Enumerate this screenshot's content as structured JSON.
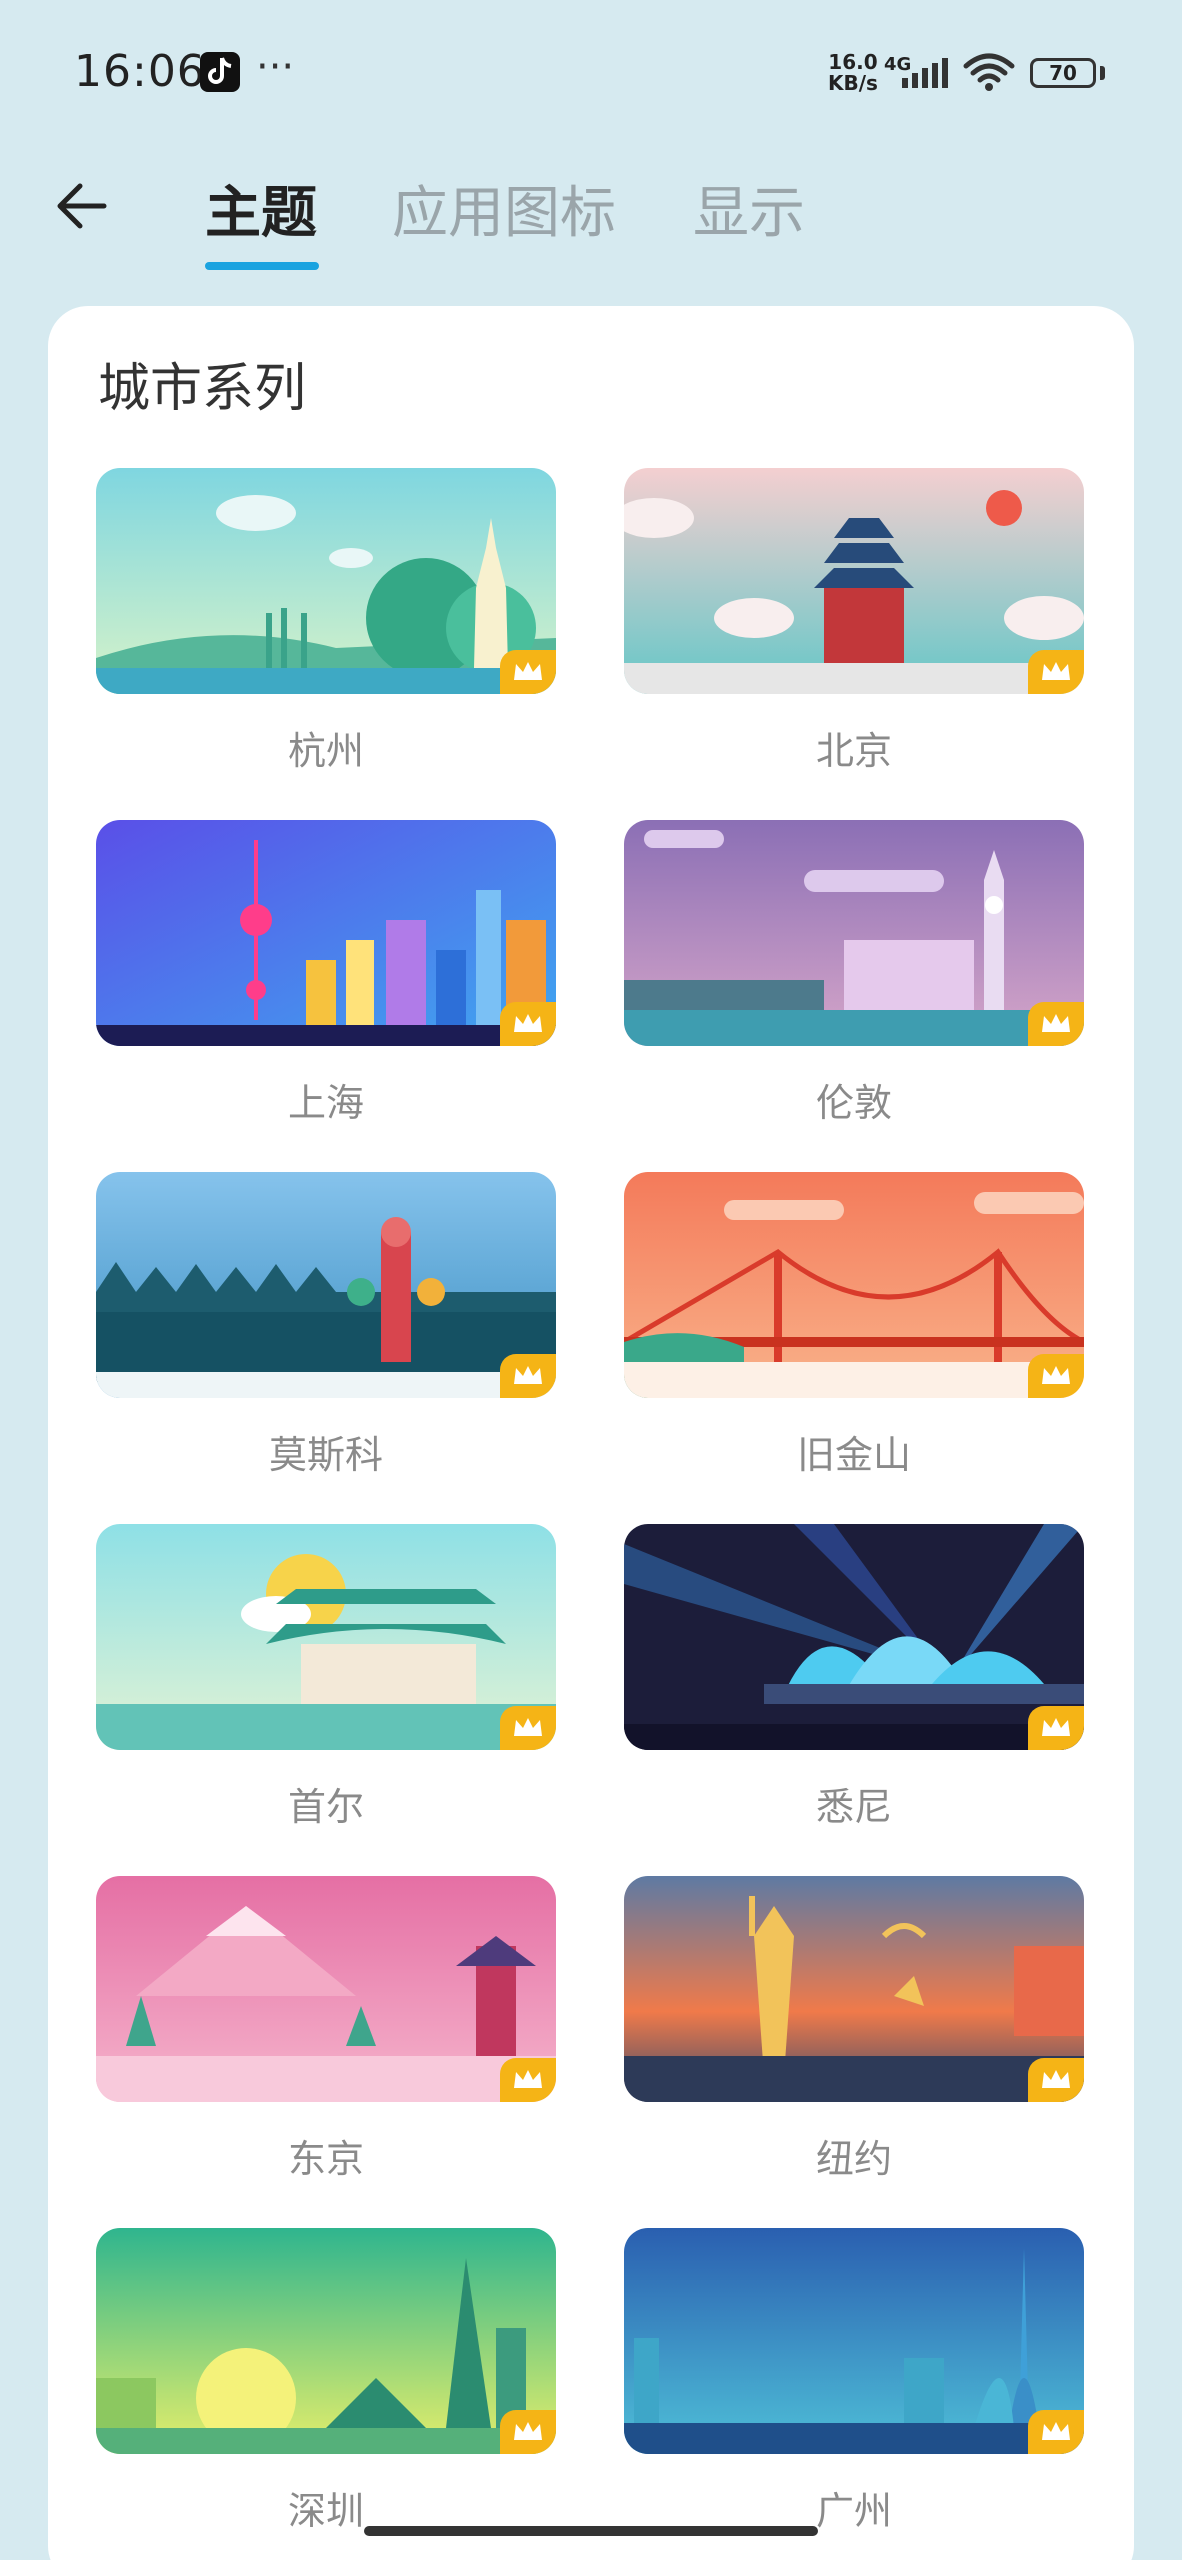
{
  "status": {
    "time": "16:06",
    "more": "···",
    "net_speed_value": "16.0",
    "net_speed_unit": "KB/s",
    "network": "4G",
    "battery": "70"
  },
  "header": {
    "tabs": [
      {
        "label": "主题",
        "active": true
      },
      {
        "label": "应用图标",
        "active": false
      },
      {
        "label": "显示",
        "active": false
      }
    ]
  },
  "section": {
    "title": "城市系列",
    "items": [
      {
        "label": "杭州",
        "premium": true
      },
      {
        "label": "北京",
        "premium": true
      },
      {
        "label": "上海",
        "premium": true
      },
      {
        "label": "伦敦",
        "premium": true
      },
      {
        "label": "莫斯科",
        "premium": true
      },
      {
        "label": "旧金山",
        "premium": true
      },
      {
        "label": "首尔",
        "premium": true
      },
      {
        "label": "悉尼",
        "premium": true
      },
      {
        "label": "东京",
        "premium": true
      },
      {
        "label": "纽约",
        "premium": true
      },
      {
        "label": "深圳",
        "premium": true
      },
      {
        "label": "广州",
        "premium": true
      }
    ]
  },
  "colors": {
    "accent": "#1aa3e0",
    "crown_badge": "#f5b416",
    "background": "#d6eaf0"
  },
  "icons": {
    "back": "arrow-left-icon",
    "premium": "crown-icon"
  }
}
